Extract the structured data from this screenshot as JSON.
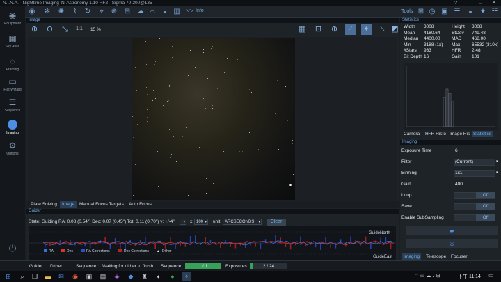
{
  "window": {
    "title": "N.I.N.A. - Nighttime Imaging 'N' Astronomy 1.10 HF2   -   Sigma 70-200@135",
    "min": "–",
    "max": "□",
    "close": "✕",
    "help": "?"
  },
  "sidebar": {
    "items": [
      {
        "label": "Equipment",
        "icon": "camera-icon"
      },
      {
        "label": "Sky Atlas",
        "icon": "map-icon"
      },
      {
        "label": "Framing",
        "icon": "framing-icon"
      },
      {
        "label": "Flat Wizard",
        "icon": "flat-wizard-icon"
      },
      {
        "label": "Sequence",
        "icon": "sequence-icon"
      },
      {
        "label": "Imaging",
        "icon": "imaging-icon"
      },
      {
        "label": "Options",
        "icon": "gear-icon"
      }
    ]
  },
  "topbar": {
    "info_label": "Info",
    "tools_label": "Tools"
  },
  "image_panel": {
    "header": "Image",
    "zoom_ratio": "1:1",
    "zoom_percent": "15 %"
  },
  "image_tabs": [
    "Plate Solving",
    "Image",
    "Manual Focus Targets",
    "Auto Focus"
  ],
  "guider": {
    "header": "Guider",
    "state_text": "State: Guiding  RA: 0.08 (0.54\")  Dec: 0.07 (0.45\")  Tot: 0.11 (0.70\")  y: +/-4\"",
    "x_label": "x:",
    "x_value": "100",
    "unit_label": "unit:",
    "unit_value": "ARCSECONDS",
    "clear_label": "Clear",
    "north_label": "GuideNorth",
    "east_label": "GuideEast",
    "legend": [
      "RA",
      "Dec",
      "RA Corrections",
      "Dec Corrections",
      "Dither"
    ],
    "colors": {
      "ra": "#3d6ee0",
      "dec": "#e03030",
      "ra_corr": "#2a4fd0",
      "dec_corr": "#c02020",
      "dither": "#ffffff"
    }
  },
  "statistics": {
    "header": "Statistics",
    "rows": [
      {
        "k1": "Width",
        "v1": "3008",
        "k2": "Height",
        "v2": "3008"
      },
      {
        "k1": "Mean",
        "v1": "4180.64",
        "k2": "StDev",
        "v2": "749.48"
      },
      {
        "k1": "Median",
        "v1": "4400.00",
        "k2": "MAD",
        "v2": "468.00"
      },
      {
        "k1": "Min",
        "v1": "3188 (1x)",
        "k2": "Max",
        "v2": "65532 (310x)"
      },
      {
        "k1": "#Stars",
        "v1": "933",
        "k2": "HFR",
        "v2": "2.48"
      },
      {
        "k1": "Bit Depth",
        "v1": "16",
        "k2": "Gain",
        "v2": "101"
      }
    ],
    "tabs": [
      "Camera",
      "HFR Histo",
      "Image His",
      "Statistics"
    ]
  },
  "imaging": {
    "header": "Imaging",
    "exposure_label": "Exposure Time",
    "exposure_value": "6",
    "filter_label": "Filter",
    "filter_value": "(Current)",
    "binning_label": "Binning",
    "binning_value": "1x1",
    "gain_label": "Gain",
    "gain_value": "400",
    "loop_label": "Loop",
    "loop_value": "Off",
    "save_label": "Save",
    "save_value": "Off",
    "subsampling_label": "Enable SubSampling",
    "subsampling_value": "Off",
    "tabs": [
      "Imaging",
      "Telescope",
      "Focuser"
    ]
  },
  "statusbar": {
    "guider_label": "Guider :",
    "guider_value": "Dither",
    "sequence_label": "Sequence :",
    "sequence_value": "Waiting for dither to finish",
    "sequence_prog_label": "Sequence",
    "sequence_prog": "1 / 1",
    "sequence_fraction": 1.0,
    "exposures_label": "Exposures",
    "exposures_prog": "2 / 24",
    "exposures_fraction": 0.083
  },
  "taskbar": {
    "time": "下午 11:14"
  }
}
